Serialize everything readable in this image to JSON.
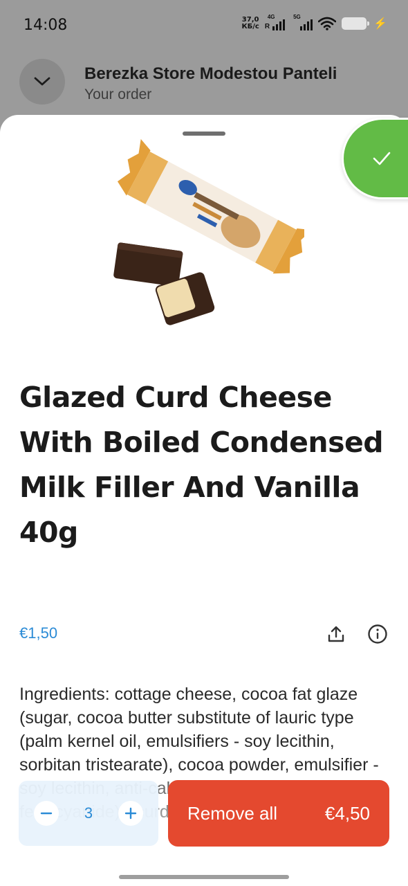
{
  "status_bar": {
    "time": "14:08",
    "net_speed_value": "37,0",
    "net_speed_unit": "КБ/с",
    "signal1_label": "4G",
    "signal1_roaming": "R",
    "signal2_label": "5G",
    "icons": [
      "signal-icon",
      "signal-icon",
      "wifi-icon",
      "battery-icon",
      "charging-icon"
    ]
  },
  "header": {
    "store_name": "Berezka Store Modestou Panteli",
    "subtitle": "Your order"
  },
  "product": {
    "title": "Glazed Curd Cheese With Boiled Condensed Milk Filler And Vanilla 40g",
    "price": "€1,50",
    "ingredients": "Ingredients: cottage cheese, cocoa fat glaze (sugar, cocoa butter substitute of lauric type (palm kernel oil, emulsifiers - soy lecithin, sorbitan tristearate), cocoa powder, emulsifier - soy lecithin, anti-caking agent - potassium ferrocyanide)), curd"
  },
  "cart": {
    "quantity": "3",
    "remove_label": "Remove all",
    "total": "€4,50"
  },
  "colors": {
    "accent_blue": "#2b8bd6",
    "remove_red": "#e4492f",
    "check_green": "#62bb46"
  }
}
